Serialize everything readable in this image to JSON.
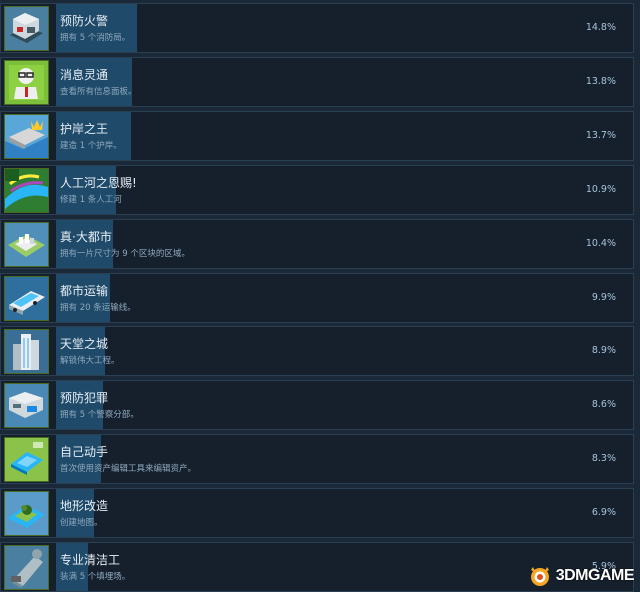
{
  "achievements": [
    {
      "title": "预防火警",
      "desc": "拥有 5 个消防局。",
      "pct": "14.8%",
      "value": 14.8,
      "icon": "fire-station-icon"
    },
    {
      "title": "消息灵通",
      "desc": "查看所有信息面板。",
      "pct": "13.8%",
      "value": 13.8,
      "icon": "advisor-icon"
    },
    {
      "title": "护岸之王",
      "desc": "建造 1 个护岸。",
      "pct": "13.7%",
      "value": 13.7,
      "icon": "quay-crown-icon"
    },
    {
      "title": "人工河之恩赐!",
      "desc": "修建 1 条人工河",
      "pct": "10.9%",
      "value": 10.9,
      "icon": "canal-icon"
    },
    {
      "title": "真·大都市",
      "desc": "拥有一片尺寸为 9 个区块的区域。",
      "pct": "10.4%",
      "value": 10.4,
      "icon": "metropolis-icon"
    },
    {
      "title": "都市运输",
      "desc": "拥有 20 条运输线。",
      "pct": "9.9%",
      "value": 9.9,
      "icon": "bus-icon"
    },
    {
      "title": "天堂之城",
      "desc": "解锁伟大工程。",
      "pct": "8.9%",
      "value": 8.9,
      "icon": "skyscraper-icon"
    },
    {
      "title": "预防犯罪",
      "desc": "拥有 5 个警察分部。",
      "pct": "8.6%",
      "value": 8.6,
      "icon": "police-station-icon"
    },
    {
      "title": "自己动手",
      "desc": "首次使用资产编辑工具来编辑资产。",
      "pct": "8.3%",
      "value": 8.3,
      "icon": "asset-editor-icon"
    },
    {
      "title": "地形改造",
      "desc": "创建地图。",
      "pct": "6.9%",
      "value": 6.9,
      "icon": "terrain-icon"
    },
    {
      "title": "专业清洁工",
      "desc": "装满 5 个填埋场。",
      "pct": "5.9%",
      "value": 5.9,
      "icon": "landfill-icon"
    }
  ],
  "watermark": {
    "text": "3DMGAME"
  }
}
